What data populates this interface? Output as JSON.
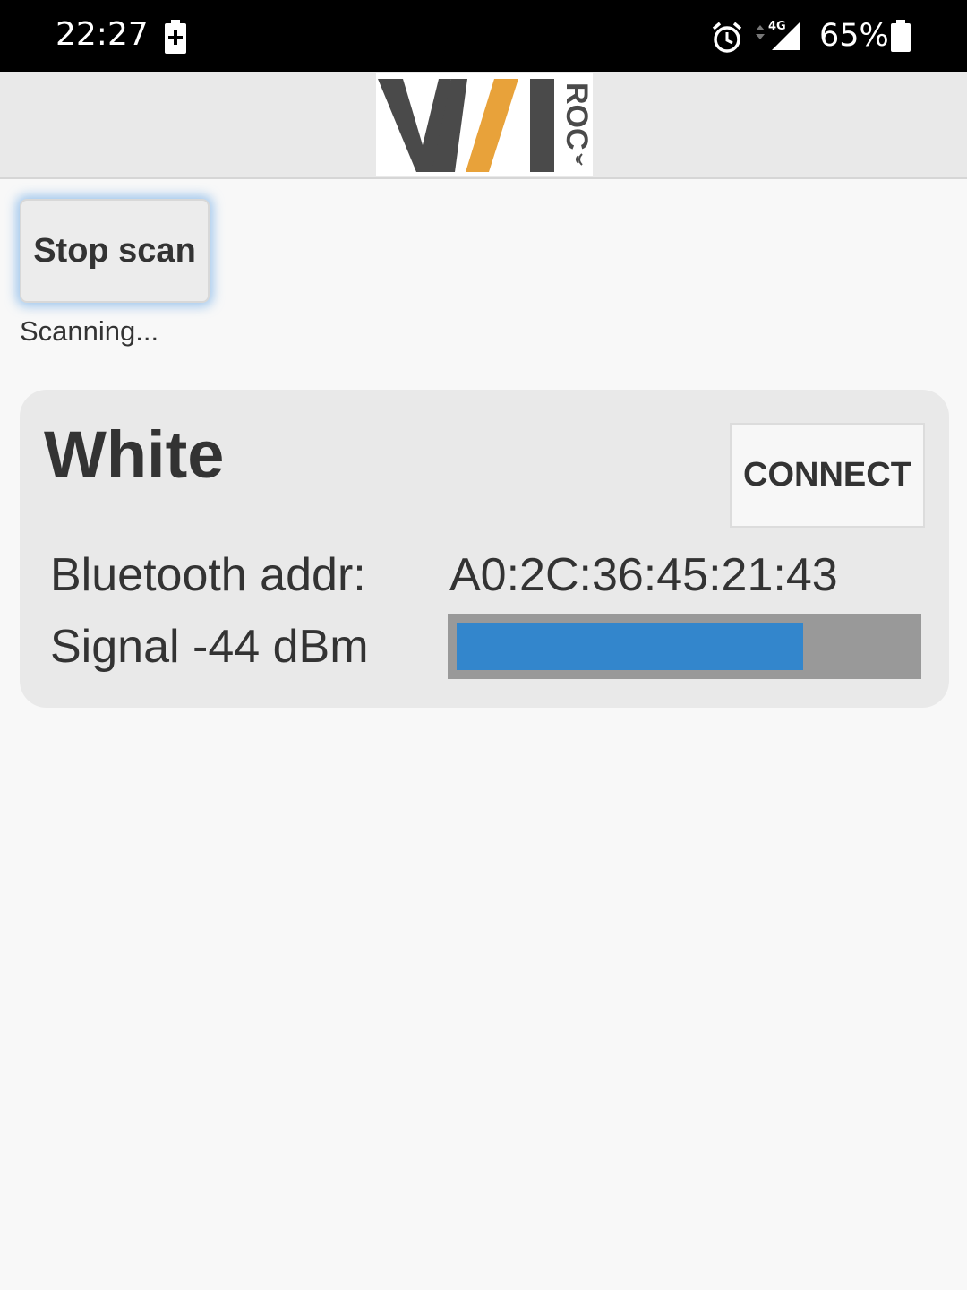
{
  "status_bar": {
    "time": "22:27",
    "battery_percent": "65%",
    "network": "4G",
    "icons": [
      "battery-charging-icon",
      "alarm-icon",
      "signal-icon",
      "battery-icon"
    ]
  },
  "header": {
    "logo_main": "WI",
    "logo_side": "ROC",
    "colors": {
      "dark": "#4a4a4a",
      "accent": "#e8a23a"
    }
  },
  "scan": {
    "button_label": "Stop scan",
    "status_text": "Scanning..."
  },
  "device": {
    "name": "White",
    "connect_label": "CONNECT",
    "addr_label": "Bluetooth addr:",
    "addr_value": "A0:2C:36:45:21:43",
    "signal_label": "Signal -44 dBm",
    "signal_level_percent": 76,
    "signal_color": "#3386cc"
  }
}
